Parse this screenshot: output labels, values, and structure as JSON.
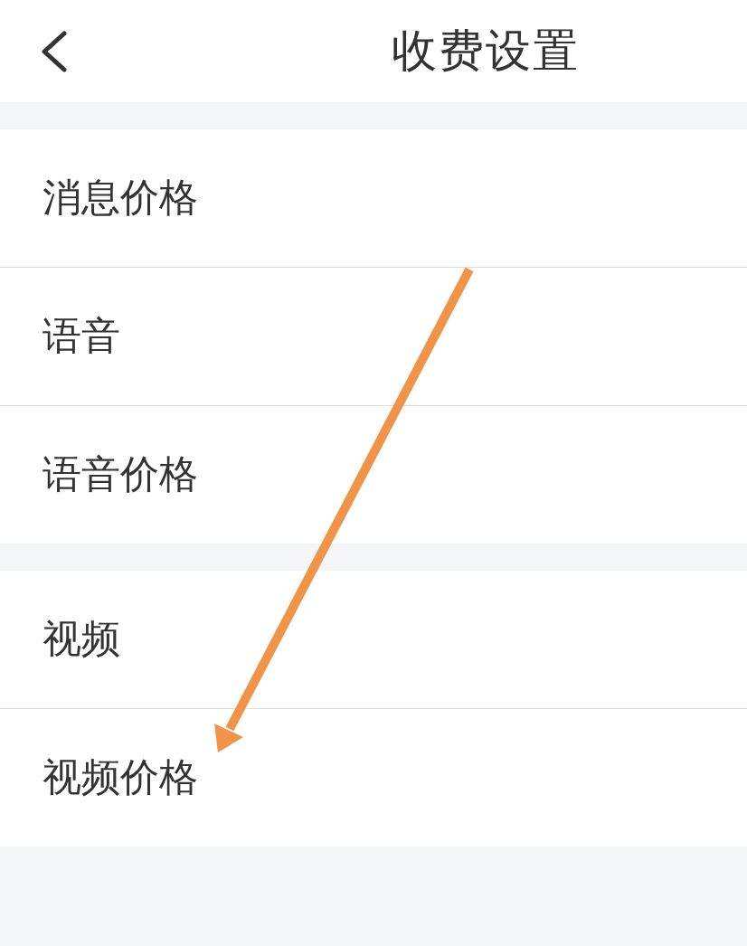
{
  "header": {
    "title": "收费设置"
  },
  "groups": [
    {
      "items": [
        {
          "label": "消息价格"
        },
        {
          "label": "语音"
        },
        {
          "label": "语音价格"
        }
      ]
    },
    {
      "items": [
        {
          "label": "视频"
        },
        {
          "label": "视频价格"
        }
      ]
    }
  ]
}
